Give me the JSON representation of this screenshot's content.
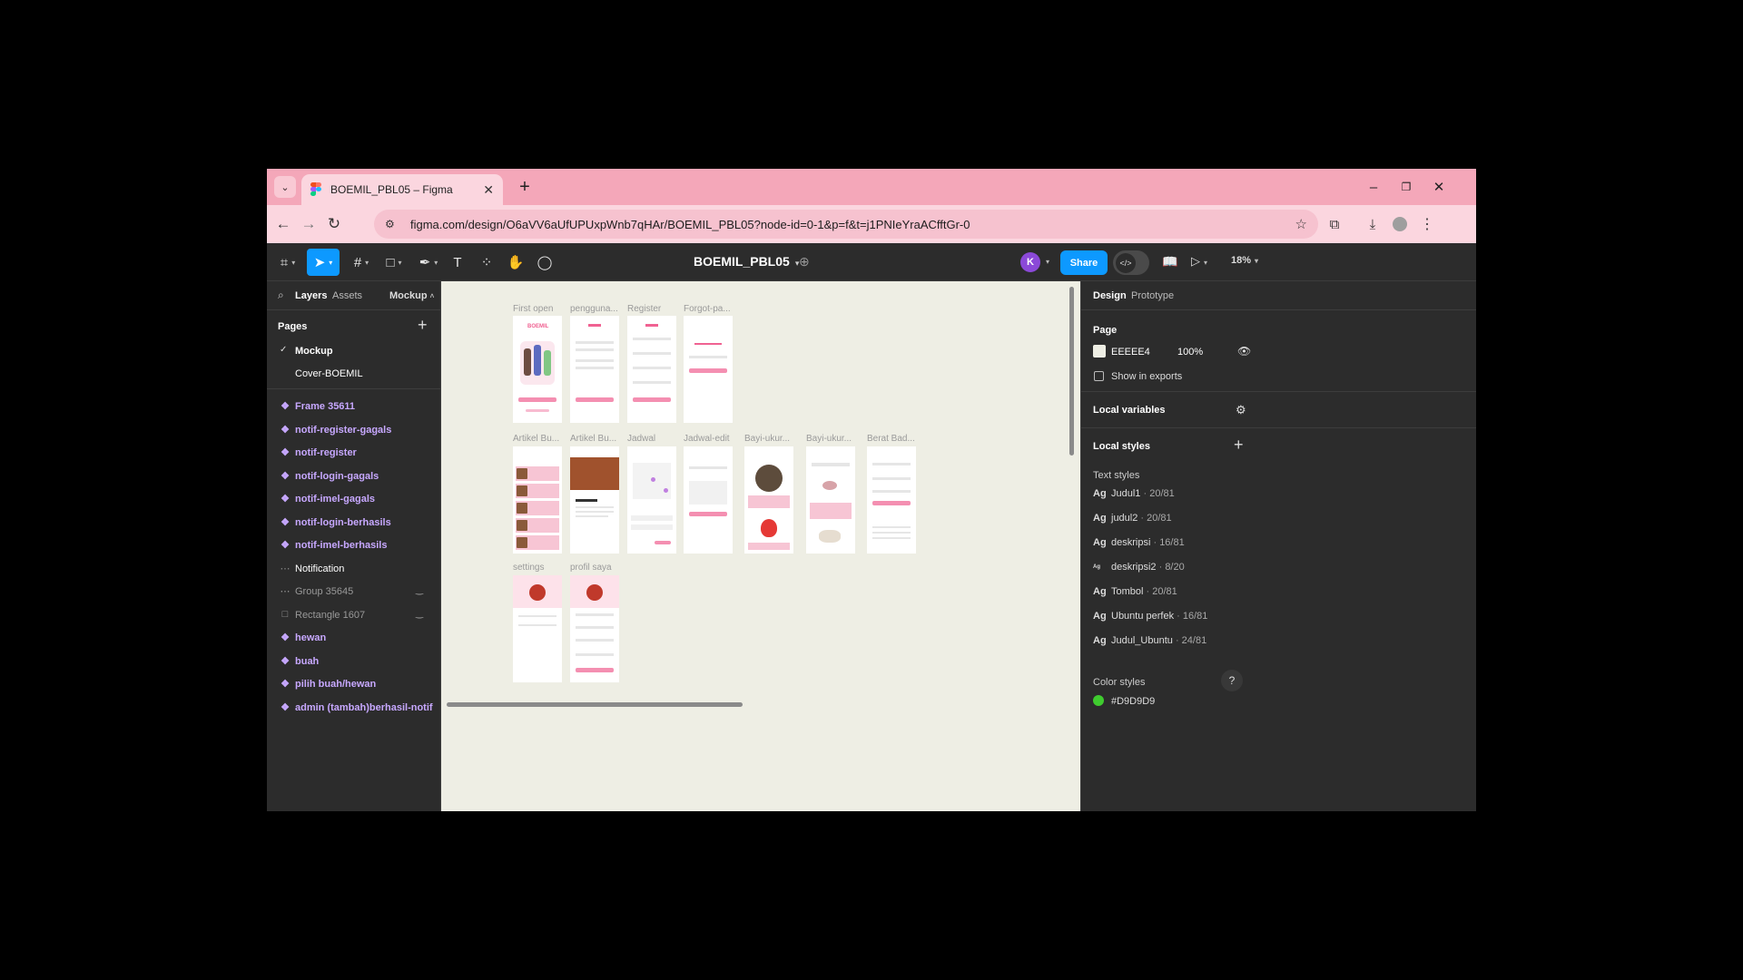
{
  "browser": {
    "tab_title": "BOEMIL_PBL05 – Figma",
    "url": "figma.com/design/O6aVV6aUfUPUxpWnb7qHAr/BOEMIL_PBL05?node-id=0-1&p=f&t=j1PNIeYraACfftGr-0"
  },
  "toolbar": {
    "doc_name": "BOEMIL_PBL05",
    "avatar_initial": "K",
    "share_label": "Share",
    "zoom": "18%"
  },
  "left_panel": {
    "tab_layers": "Layers",
    "tab_assets": "Assets",
    "page_selector": "Mockup",
    "pages_heading": "Pages",
    "pages": [
      {
        "name": "Mockup",
        "current": true
      },
      {
        "name": "Cover-BOEMIL",
        "current": false
      }
    ],
    "layers": [
      {
        "name": "Frame 35611",
        "kind": "component"
      },
      {
        "name": "notif-register-gagals",
        "kind": "component"
      },
      {
        "name": "notif-register",
        "kind": "component"
      },
      {
        "name": "notif-login-gagals",
        "kind": "component"
      },
      {
        "name": "notif-imel-gagals",
        "kind": "component"
      },
      {
        "name": "notif-login-berhasils",
        "kind": "component"
      },
      {
        "name": "notif-imel-berhasils",
        "kind": "component"
      },
      {
        "name": "Notification",
        "kind": "frame"
      },
      {
        "name": "Group 35645",
        "kind": "hidden"
      },
      {
        "name": "Rectangle 1607",
        "kind": "hidden"
      },
      {
        "name": "hewan",
        "kind": "component"
      },
      {
        "name": "buah",
        "kind": "component"
      },
      {
        "name": "pilih buah/hewan",
        "kind": "component"
      },
      {
        "name": "admin (tambah)berhasil-notif",
        "kind": "component"
      }
    ]
  },
  "canvas": {
    "background": "#EEEEE4",
    "frame_labels": [
      "First open",
      "pengguna...",
      "Register",
      "Forgot-pa...",
      "Artikel Bu...",
      "Artikel Bu...",
      "Jadwal",
      "Jadwal-edit",
      "Bayi-ukur...",
      "Bayi-ukur...",
      "Berat Bad...",
      "settings",
      "profil saya"
    ]
  },
  "right_panel": {
    "tab_design": "Design",
    "tab_prototype": "Prototype",
    "page_heading": "Page",
    "page_color_hex": "EEEEE4",
    "page_opacity": "100%",
    "show_in_exports": "Show in exports",
    "local_variables": "Local variables",
    "local_styles": "Local styles",
    "text_styles_heading": "Text styles",
    "text_styles": [
      {
        "name": "Judul1",
        "spec": "20/81"
      },
      {
        "name": "judul2",
        "spec": "20/81"
      },
      {
        "name": "deskripsi",
        "spec": "16/81"
      },
      {
        "name": "deskripsi2",
        "spec": "8/20"
      },
      {
        "name": "Tombol",
        "spec": "20/81"
      },
      {
        "name": "Ubuntu perfek",
        "spec": "16/81"
      },
      {
        "name": "Judul_Ubuntu",
        "spec": "24/81"
      }
    ],
    "color_styles_heading": "Color styles",
    "color_style_first": "#D9D9D9",
    "help": "?"
  },
  "colors": {
    "browser_chrome": "#F4A7B9",
    "figma_blue": "#0D99FF",
    "component_purple": "#C7A8FF",
    "mockup_pink": "#F48FB1"
  },
  "icons": [
    "chevron-down-icon",
    "figma-favicon",
    "close-icon",
    "plus-icon",
    "minimize-icon",
    "restore-icon",
    "back-icon",
    "forward-icon",
    "reload-icon",
    "site-settings-icon",
    "star-icon",
    "extensions-icon",
    "download-icon",
    "profile-icon",
    "kebab-menu-icon",
    "figma-menu-icon",
    "move-tool-icon",
    "frame-tool-icon",
    "shape-tool-icon",
    "pen-tool-icon",
    "text-tool-icon",
    "components-icon",
    "hand-tool-icon",
    "comment-icon",
    "globe-icon",
    "dev-mode-icon",
    "library-icon",
    "play-icon",
    "search-icon",
    "checkmark-icon",
    "component-icon",
    "frame-icon",
    "eye-icon",
    "variables-icon",
    "help-icon"
  ]
}
